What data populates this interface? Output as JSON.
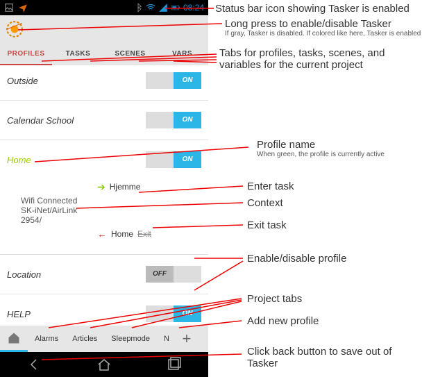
{
  "statusbar": {
    "time": "08:24"
  },
  "tabs": {
    "t0": "PROFILES",
    "t1": "TASKS",
    "t2": "SCENES",
    "t3": "VARS"
  },
  "profiles": {
    "p0": {
      "name": "Outside",
      "state": "ON"
    },
    "p1": {
      "name": "Calendar School",
      "state": "ON"
    },
    "p2": {
      "name": "Home",
      "state": "ON"
    },
    "p3": {
      "name": "Location",
      "state": "OFF"
    },
    "p4": {
      "name": "HELP",
      "state": "ON"
    }
  },
  "expanded": {
    "context_line1": "Wifi Connected",
    "context_line2": "SK-iNet/AirLink",
    "context_line3": "2954/",
    "enter_task": "Hjemme",
    "exit_task_prefix": "Home",
    "exit_task_strike": "Exit"
  },
  "projects": {
    "p0": "Alarms",
    "p1": "Articles",
    "p2": "Sleepmode",
    "p3": "N"
  },
  "annotations": {
    "a0": {
      "text": "Status bar icon showing Tasker is enabled"
    },
    "a1": {
      "text": "Long press to enable/disable Tasker",
      "sub": "If gray, Tasker is disabled. If colored like here, Tasker is enabled"
    },
    "a2": {
      "text": "Tabs for profiles, tasks, scenes, and variables for the current project"
    },
    "a3": {
      "text": "Profile name",
      "sub": "When green, the profile is currently active"
    },
    "a4": {
      "text": "Enter task"
    },
    "a5": {
      "text": "Context"
    },
    "a6": {
      "text": "Exit task"
    },
    "a7": {
      "text": "Enable/disable profile"
    },
    "a8": {
      "text": "Project tabs"
    },
    "a9": {
      "text": "Add new profile"
    },
    "a10": {
      "text": "Click back button to save out of Tasker"
    }
  }
}
